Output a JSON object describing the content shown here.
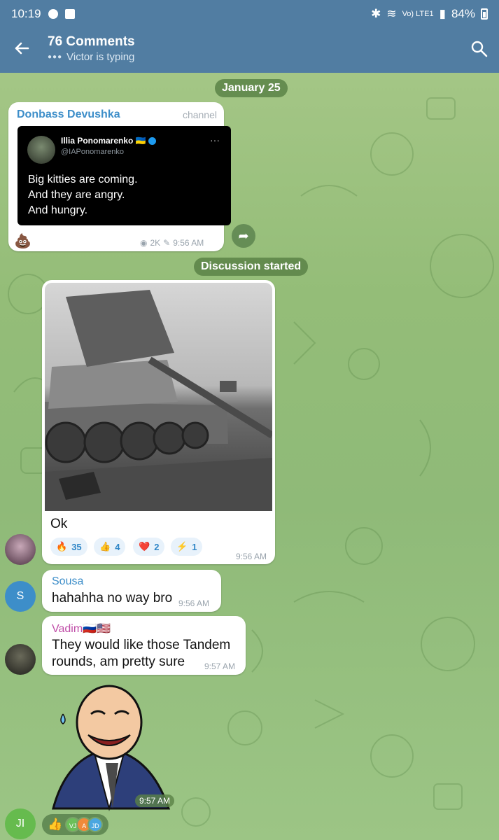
{
  "status_bar": {
    "time": "10:19",
    "network": "Vo) LTE1",
    "battery": "84%"
  },
  "header": {
    "title": "76 Comments",
    "subtitle": "Victor is typing",
    "back_icon": "arrow-back-icon",
    "search_icon": "search-icon"
  },
  "date_pill": "January 25",
  "channel_post": {
    "channel_name": "Donbass Devushka",
    "tag": "channel",
    "tweet": {
      "author": "Illia Ponomarenko 🇺🇦",
      "handle": "@IAPonomarenko",
      "more": "···",
      "lines": [
        "Big kitties are coming.",
        "And they are angry.",
        "And hungry."
      ]
    },
    "reaction_emoji": "💩",
    "views": "2K",
    "time": "9:56 AM"
  },
  "discussion_pill": "Discussion started",
  "messages": [
    {
      "text": "Ok",
      "time": "9:56 AM",
      "reactions": [
        {
          "emoji": "🔥",
          "count": "35"
        },
        {
          "emoji": "👍",
          "count": "4"
        },
        {
          "emoji": "❤️",
          "count": "2"
        },
        {
          "emoji": "⚡",
          "count": "1"
        }
      ]
    },
    {
      "author": "Sousa",
      "avatar_letter": "S",
      "text": "hahahha no way bro",
      "time": "9:56 AM"
    },
    {
      "author": "Vadim🇷🇺🇺🇸",
      "lines": [
        "They would like those Tandem",
        "rounds, am pretty sure"
      ],
      "time": "9:57 AM"
    },
    {
      "sticker_time": "9:57 AM",
      "avatar_initials": "JI",
      "reaction_emoji": "👍",
      "reactors": [
        "VJ",
        "A",
        "JD"
      ]
    }
  ],
  "colors": {
    "header": "#517da2",
    "accent_blue": "#2f86c7",
    "sousa_name": "#3d8ec9",
    "vadim_name": "#c04ea8",
    "donbass_name": "#3d8ec9"
  }
}
